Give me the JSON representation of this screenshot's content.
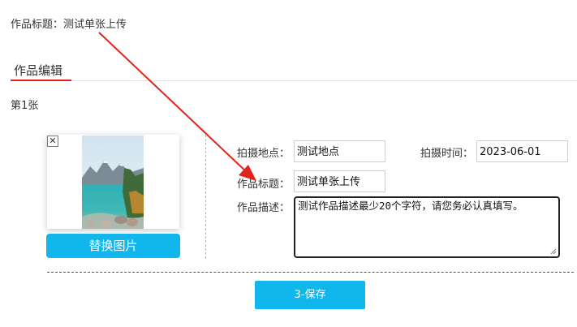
{
  "header": {
    "work_title_line": "作品标题：测试单张上传",
    "section_tab": "作品编辑",
    "page_count": "第1张"
  },
  "image_card": {
    "delete_icon": "close-icon",
    "delete_glyph": "✕",
    "replace_button": "替换图片"
  },
  "form": {
    "location_label": "拍摄地点：",
    "location_value": "测试地点",
    "time_label": "拍摄时间：",
    "time_value": "2023-06-01",
    "title_label": "作品标题：",
    "title_value": "测试单张上传",
    "description_label": "作品描述：",
    "description_value": "测试作品描述最少20个字符，请您务必认真填写。"
  },
  "actions": {
    "save_button": "3-保存"
  },
  "colors": {
    "accent": "#11b6ec",
    "tab_underline": "#e2231a",
    "annotation_arrow": "#e2231a"
  }
}
